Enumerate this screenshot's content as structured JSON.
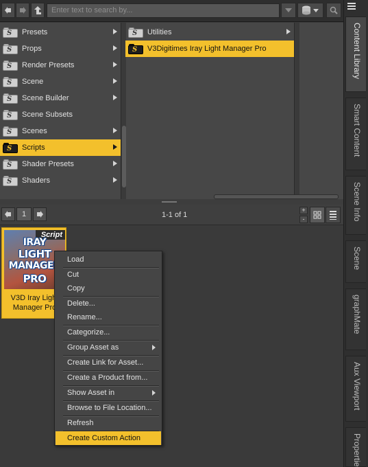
{
  "search": {
    "placeholder": "Enter text to search by..."
  },
  "categories": [
    {
      "label": "Presets"
    },
    {
      "label": "Props"
    },
    {
      "label": "Render Presets"
    },
    {
      "label": "Scene"
    },
    {
      "label": "Scene Builder"
    },
    {
      "label": "Scene Subsets"
    },
    {
      "label": "Scenes"
    },
    {
      "label": "Scripts"
    },
    {
      "label": "Shader Presets"
    },
    {
      "label": "Shaders"
    }
  ],
  "subcategories": [
    {
      "label": "Utilities"
    },
    {
      "label": "V3Digitimes Iray Light Manager Pro"
    }
  ],
  "pager": {
    "page": "1",
    "count": "1-1 of 1"
  },
  "asset": {
    "badge": "Script",
    "thumb_lines": [
      "IRAY",
      "LIGHT",
      "MANAGER",
      "PRO"
    ],
    "caption": "V3D Iray Light Manager Pro"
  },
  "menu": {
    "items": [
      {
        "label": "Load"
      },
      {
        "label": "Cut"
      },
      {
        "label": "Copy"
      },
      {
        "label": "Delete..."
      },
      {
        "label": "Rename..."
      },
      {
        "label": "Categorize..."
      },
      {
        "label": "Group Asset as"
      },
      {
        "label": "Create Link for Asset..."
      },
      {
        "label": "Create a Product from..."
      },
      {
        "label": "Show Asset in"
      },
      {
        "label": "Browse to File Location..."
      },
      {
        "label": "Refresh"
      },
      {
        "label": "Create Custom Action"
      }
    ]
  },
  "tabs": [
    {
      "label": "Content Library"
    },
    {
      "label": "Smart Content"
    },
    {
      "label": "Scene Info"
    },
    {
      "label": "Scene"
    },
    {
      "label": "graphMate"
    },
    {
      "label": "Aux Viewport"
    },
    {
      "label": "Properties"
    }
  ],
  "colors": {
    "highlight": "#f3c02c",
    "panel": "#474747",
    "background": "#3a3a3a"
  }
}
